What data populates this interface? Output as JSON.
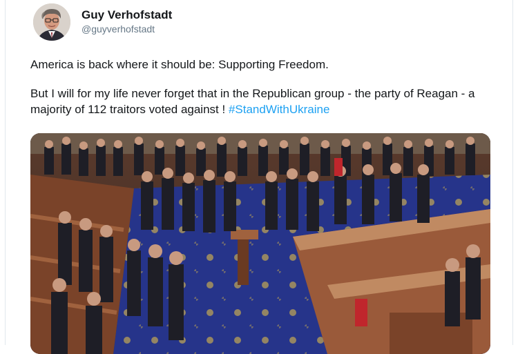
{
  "author": {
    "display_name": "Guy Verhofstadt",
    "handle": "@guyverhofstadt",
    "avatar_icon": "profile-photo"
  },
  "tweet": {
    "paragraph1": "America is back where it should be: Supporting Freedom.",
    "paragraph2": "But I will for my life never forget that in the Republican group - the party of Reagan - a majority of 112 traitors voted against !",
    "hashtag": "#StandWithUkraine"
  },
  "media": {
    "kind": "photo",
    "description_icon": "house-chamber-photo"
  },
  "colors": {
    "link": "#1da1f2",
    "secondary_text": "#657786",
    "border": "#e1e8ed",
    "carpet": "#2a3a8c",
    "wood": "#8a4a2c"
  }
}
